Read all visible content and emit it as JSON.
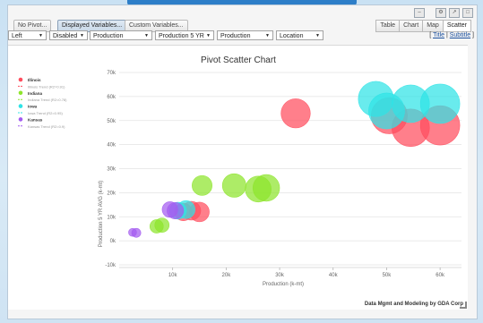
{
  "toolbar": {
    "pivot_label": "No Pivot...",
    "displayed_vars_label": "Displayed Variables...",
    "custom_vars_label": "Custom Variables...",
    "view_tabs": [
      "Table",
      "Chart",
      "Map",
      "Scatter"
    ],
    "active_view": "Scatter"
  },
  "selectors": {
    "position": "Left",
    "mode": "Disabled",
    "x_var": "Production",
    "y_var": "Production 5 YR",
    "size_var": "Production",
    "color_var": "Location"
  },
  "title_links": {
    "title": "Title",
    "subtitle": "Subtitle"
  },
  "footer_credit": "Data Mgmt and Modeling by GDA Corp",
  "colors": {
    "illinois": "#ff4d5e",
    "indiana": "#8ee52d",
    "iowa": "#2fe3e6",
    "kansas": "#a35bf0",
    "accent": "#2d7ec8"
  },
  "chart_data": {
    "type": "scatter",
    "title": "Pivot Scatter Chart",
    "xlabel": "Production (k-mt)",
    "ylabel": "Production 5 YR AVG (k-mt)",
    "xlim": [
      0,
      64000
    ],
    "ylim": [
      -10000,
      70000
    ],
    "x_ticks": [
      10000,
      20000,
      30000,
      40000,
      50000,
      60000
    ],
    "x_tick_labels": [
      "10k",
      "20k",
      "30k",
      "40k",
      "50k",
      "60k"
    ],
    "y_ticks": [
      -10000,
      0,
      10000,
      20000,
      30000,
      40000,
      50000,
      60000,
      70000
    ],
    "y_tick_labels": [
      "-10k",
      "0k",
      "10k",
      "20k",
      "30k",
      "40k",
      "50k",
      "60k",
      "70k"
    ],
    "grid": "horizontal",
    "legend_position": "top-left",
    "legend": [
      {
        "name": "Illinois",
        "color": "#ff4d5e",
        "kind": "marker"
      },
      {
        "name": "Illinois Trend (R2=0.91)",
        "color": "#ff4d5e",
        "kind": "trend"
      },
      {
        "name": "Indiana",
        "color": "#8ee52d",
        "kind": "marker"
      },
      {
        "name": "Indiana Trend (R2=0.78)",
        "color": "#8ee52d",
        "kind": "trend"
      },
      {
        "name": "Iowa",
        "color": "#2fe3e6",
        "kind": "marker"
      },
      {
        "name": "Iowa Trend (R2=0.95)",
        "color": "#2fe3e6",
        "kind": "trend"
      },
      {
        "name": "Kansas",
        "color": "#a35bf0",
        "kind": "marker"
      },
      {
        "name": "Kansas Trend (R2=0.9)",
        "color": "#a35bf0",
        "kind": "trend"
      }
    ],
    "series": [
      {
        "name": "Illinois",
        "color": "#ff4d5e",
        "points": [
          {
            "x": 12000,
            "y": 12000,
            "size": 12000
          },
          {
            "x": 13500,
            "y": 12500,
            "size": 13500
          },
          {
            "x": 15000,
            "y": 12000,
            "size": 15000
          },
          {
            "x": 33000,
            "y": 53000,
            "size": 33000
          },
          {
            "x": 50500,
            "y": 52000,
            "size": 50500
          },
          {
            "x": 54500,
            "y": 47000,
            "size": 54500
          },
          {
            "x": 60000,
            "y": 48000,
            "size": 60000
          }
        ]
      },
      {
        "name": "Indiana",
        "color": "#8ee52d",
        "points": [
          {
            "x": 7000,
            "y": 6000,
            "size": 7000
          },
          {
            "x": 8000,
            "y": 6500,
            "size": 8000
          },
          {
            "x": 15500,
            "y": 23000,
            "size": 15500
          },
          {
            "x": 21500,
            "y": 23000,
            "size": 21500
          },
          {
            "x": 26000,
            "y": 21500,
            "size": 26000
          },
          {
            "x": 27500,
            "y": 22000,
            "size": 27500
          }
        ]
      },
      {
        "name": "Iowa",
        "color": "#2fe3e6",
        "points": [
          {
            "x": 11000,
            "y": 12500,
            "size": 11000
          },
          {
            "x": 12500,
            "y": 13000,
            "size": 12500
          },
          {
            "x": 48000,
            "y": 59000,
            "size": 48000
          },
          {
            "x": 50000,
            "y": 54000,
            "size": 50000
          },
          {
            "x": 54500,
            "y": 57000,
            "size": 54500
          },
          {
            "x": 60000,
            "y": 57000,
            "size": 60000
          }
        ]
      },
      {
        "name": "Kansas",
        "color": "#a35bf0",
        "points": [
          {
            "x": 2500,
            "y": 3500,
            "size": 2500
          },
          {
            "x": 3200,
            "y": 3300,
            "size": 3200
          },
          {
            "x": 9500,
            "y": 13000,
            "size": 9500
          },
          {
            "x": 10500,
            "y": 12500,
            "size": 10500
          }
        ]
      }
    ]
  }
}
